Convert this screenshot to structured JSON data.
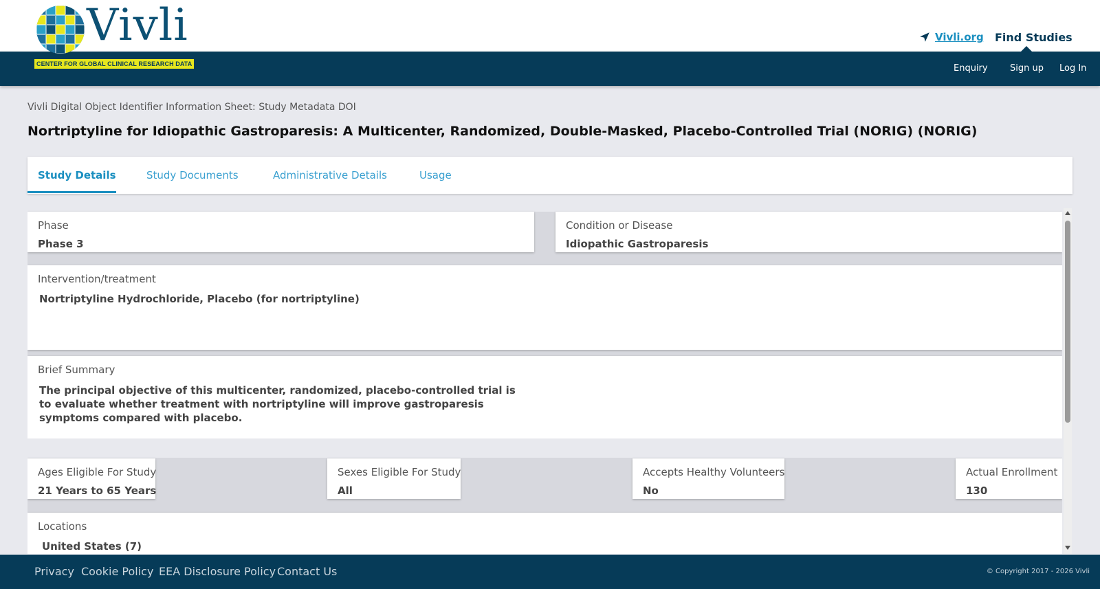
{
  "header": {
    "logo_word": "Vivli",
    "logo_sub": "CENTER FOR GLOBAL CLINICAL RESEARCH DATA",
    "ext_link": "Vivli.org",
    "find_studies": "Find Studies",
    "nav": [
      "Enquiry",
      "Sign up",
      "Log In"
    ]
  },
  "page": {
    "breadcrumb": "Vivli Digital Object Identifier Information Sheet: Study Metadata DOI",
    "title": "Nortriptyline for Idiopathic Gastroparesis: A Multicenter, Randomized, Double-Masked, Placebo-Controlled Trial (NORIG) (NORIG)"
  },
  "tabs": [
    "Study Details",
    "Study Documents",
    "Administrative Details",
    "Usage"
  ],
  "details": {
    "phase_label": "Phase",
    "phase_value": "Phase 3",
    "condition_label": "Condition or Disease",
    "condition_value": "Idiopathic Gastroparesis",
    "intervention_label": "Intervention/treatment",
    "intervention_value": "Nortriptyline Hydrochloride, Placebo (for nortriptyline)",
    "summary_label": "Brief Summary",
    "summary_value": "The principal objective of this multicenter, randomized, placebo-controlled trial is to evaluate whether treatment with nortriptyline will improve gastroparesis symptoms compared with placebo.",
    "ages_label": "Ages Eligible For Study",
    "ages_value": "21 Years to 65 Years",
    "sexes_label": "Sexes Eligible For Study",
    "sexes_value": "All",
    "healthy_label": "Accepts Healthy Volunteers",
    "healthy_value": "No",
    "enrollment_label": "Actual Enrollment",
    "enrollment_value": "130",
    "locations_label": "Locations",
    "locations_value": "United States (7)"
  },
  "footer": {
    "links": [
      "Privacy",
      "Cookie Policy",
      "EEA Disclosure Policy",
      "Contact Us"
    ],
    "copyright": "© Copyright 2017 - 2026 Vivli"
  },
  "colors": {
    "navy": "#063b58",
    "link_blue": "#1a8fc0",
    "logo_yellow": "#e6e61e"
  },
  "icons": {
    "ext_link": "location-arrow-icon"
  }
}
